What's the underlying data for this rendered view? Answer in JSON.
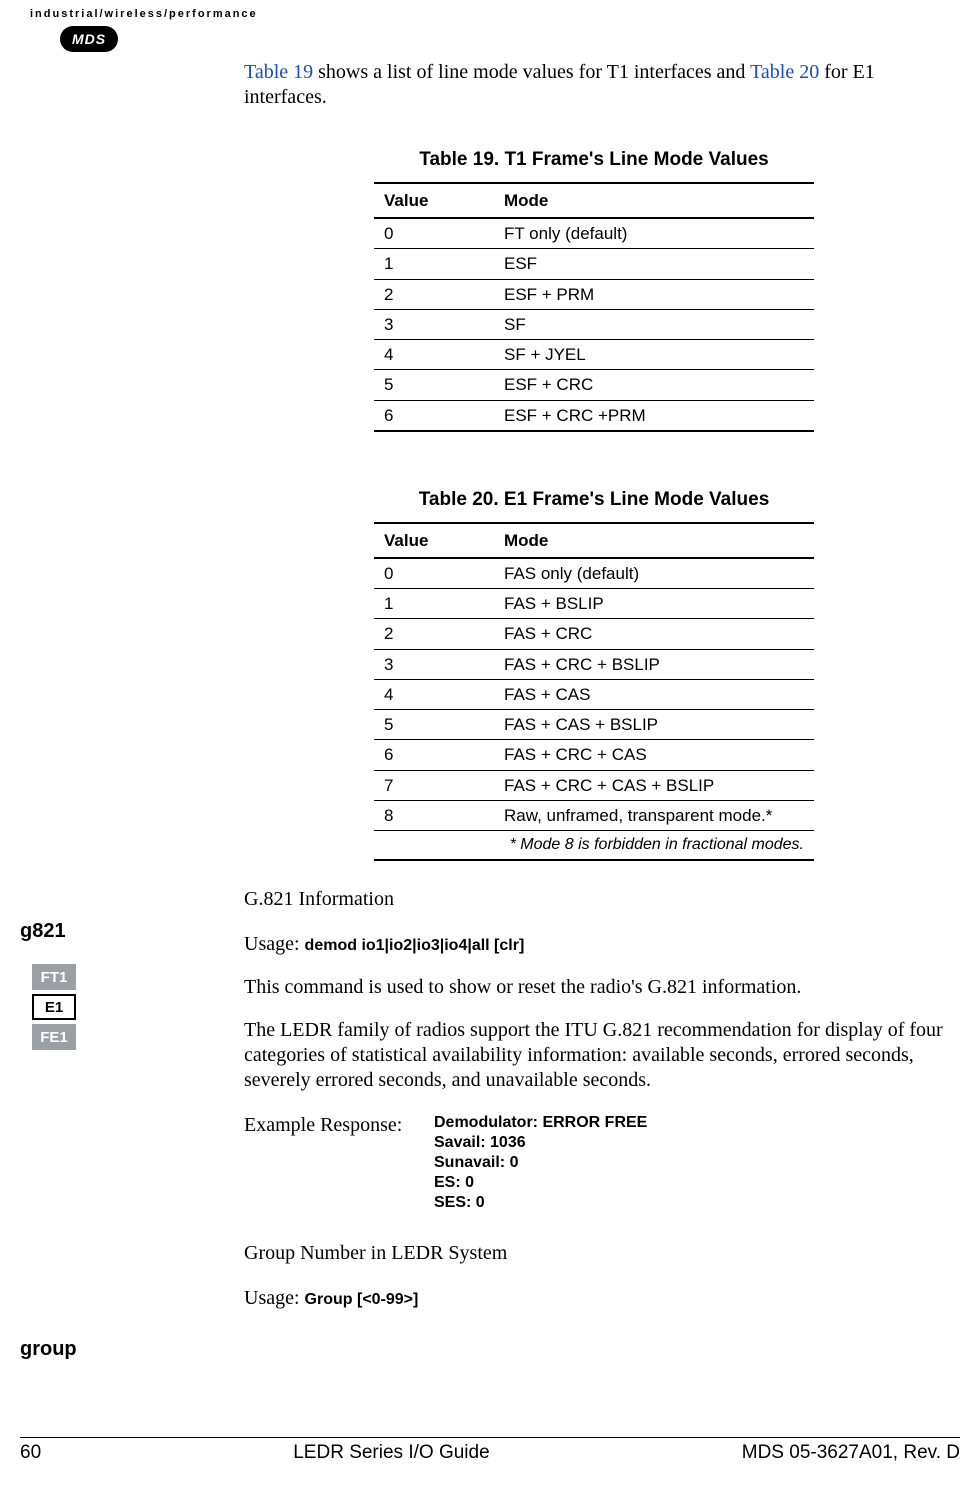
{
  "header": {
    "tagline": "industrial/wireless/performance",
    "logo": "MDS"
  },
  "intro": {
    "pre": " shows a list of line mode values for T1 interfaces and ",
    "link1": "Table 19",
    "link2": "Table 20",
    "post": " for E1 interfaces."
  },
  "table19": {
    "caption": "Table 19. T1 Frame's Line Mode Values",
    "h1": "Value",
    "h2": "Mode",
    "rows": [
      {
        "v": "0",
        "m": "FT only (default)"
      },
      {
        "v": "1",
        "m": "ESF"
      },
      {
        "v": "2",
        "m": "ESF + PRM"
      },
      {
        "v": "3",
        "m": "SF"
      },
      {
        "v": "4",
        "m": "SF + JYEL"
      },
      {
        "v": "5",
        "m": "ESF + CRC"
      },
      {
        "v": "6",
        "m": "ESF + CRC +PRM"
      }
    ]
  },
  "table20": {
    "caption": "Table 20. E1 Frame's Line Mode Values",
    "h1": "Value",
    "h2": "Mode",
    "rows": [
      {
        "v": "0",
        "m": "FAS only (default)"
      },
      {
        "v": "1",
        "m": "FAS + BSLIP"
      },
      {
        "v": "2",
        "m": "FAS + CRC"
      },
      {
        "v": "3",
        "m": "FAS + CRC + BSLIP"
      },
      {
        "v": "4",
        "m": "FAS + CAS"
      },
      {
        "v": "5",
        "m": "FAS + CAS + BSLIP"
      },
      {
        "v": "6",
        "m": "FAS + CRC + CAS"
      },
      {
        "v": "7",
        "m": "FAS + CRC + CAS + BSLIP"
      },
      {
        "v": "8",
        "m": "Raw, unframed, transparent mode.*"
      }
    ],
    "footnote": "* Mode 8 is forbidden in fractional modes."
  },
  "g821": {
    "label": "g821",
    "title": "G.821 Information",
    "badges": [
      "FT1",
      "E1",
      "FE1"
    ],
    "usage_label": "Usage: ",
    "usage_code": "demod io1|io2|io3|io4|all [clr]",
    "desc1": "This command is used to show or reset the radio's G.821 information.",
    "desc2": "The LEDR family of radios support the ITU G.821 recommendation for display of four categories of statistical availability information: available seconds, errored seconds, severely errored seconds, and unavailable seconds.",
    "example_label": "Example Response:",
    "example_lines": "Demodulator: ERROR FREE\nSavail: 1036\nSunavail: 0\nES: 0\nSES: 0"
  },
  "group": {
    "label": "group",
    "title": "Group Number in LEDR System",
    "usage_label": "Usage: ",
    "usage_code": "Group [<0-99>]"
  },
  "footer": {
    "page": "60",
    "center": "LEDR Series I/O Guide",
    "right": "MDS 05-3627A01, Rev. D"
  }
}
